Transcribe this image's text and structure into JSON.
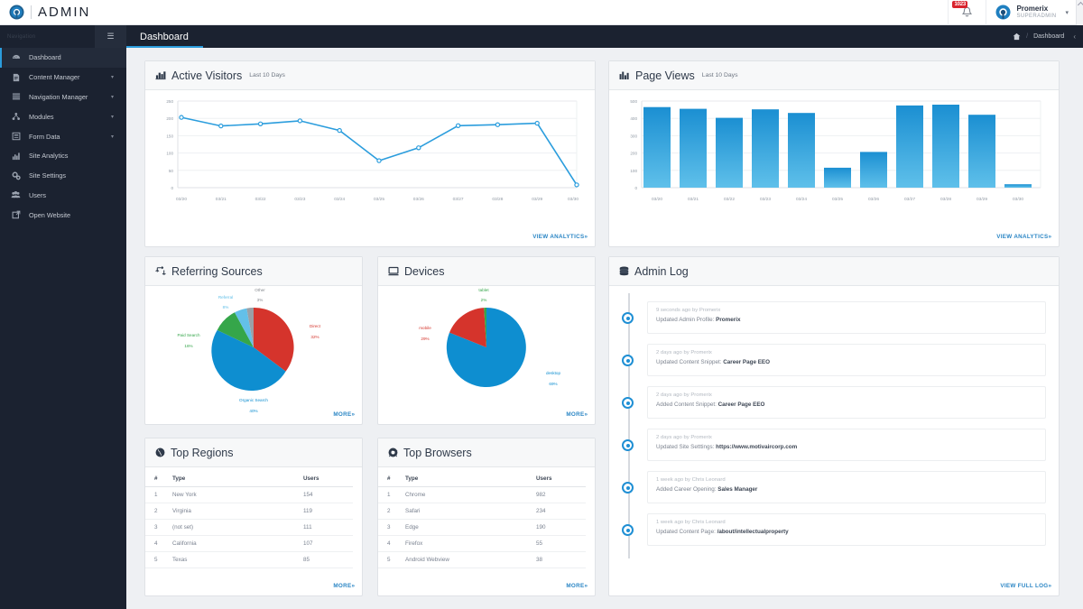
{
  "topbar": {
    "brand": "ADMIN",
    "brand_logo_icon": "target-logo-icon",
    "notification_icon": "bell-icon",
    "notification_count": "1023",
    "user_name": "Promerix",
    "user_role": "SUPERADMIN",
    "user_avatar_icon": "avatar-icon",
    "caret_icon": "chevron-down-icon"
  },
  "navstrip": {
    "nav_label": "Navigation",
    "toggle_icon": "hamburger-icon",
    "page_title": "Dashboard",
    "home_icon": "home-icon",
    "crumb_sep": "/",
    "crumb_current": "Dashboard",
    "collapse_icon": "chevron-left-icon"
  },
  "sidebar": {
    "items": [
      {
        "label": "Dashboard",
        "icon": "dashboard-icon",
        "active": true,
        "caret": false
      },
      {
        "label": "Content Manager",
        "icon": "file-icon",
        "active": false,
        "caret": true
      },
      {
        "label": "Navigation Manager",
        "icon": "list-icon",
        "active": false,
        "caret": true
      },
      {
        "label": "Modules",
        "icon": "modules-icon",
        "active": false,
        "caret": true
      },
      {
        "label": "Form Data",
        "icon": "form-icon",
        "active": false,
        "caret": true
      },
      {
        "label": "Site Analytics",
        "icon": "bar-chart-icon",
        "active": false,
        "caret": false
      },
      {
        "label": "Site Settings",
        "icon": "gear-icon",
        "active": false,
        "caret": false
      },
      {
        "label": "Users",
        "icon": "users-icon",
        "active": false,
        "caret": false
      },
      {
        "label": "Open Website",
        "icon": "external-link-icon",
        "active": false,
        "caret": false
      }
    ],
    "caret_icon": "chevron-down-icon"
  },
  "panels": {
    "active_visitors": {
      "title": "Active Visitors",
      "subtitle": "Last 10 Days",
      "icon": "area-chart-icon",
      "footer": "VIEW ANALYTICS",
      "footer_chev": "»"
    },
    "page_views": {
      "title": "Page Views",
      "subtitle": "Last 10 Days",
      "icon": "bar-chart-icon",
      "footer": "VIEW ANALYTICS",
      "footer_chev": "»"
    },
    "referring_sources": {
      "title": "Referring Sources",
      "icon": "retweet-icon",
      "footer": "MORE",
      "footer_chev": "»"
    },
    "devices": {
      "title": "Devices",
      "icon": "desktop-icon",
      "footer": "MORE",
      "footer_chev": "»"
    },
    "top_regions": {
      "title": "Top Regions",
      "icon": "globe-icon",
      "footer": "MORE",
      "footer_chev": "»",
      "columns": [
        "#",
        "Type",
        "Users"
      ],
      "rows": [
        {
          "rank": "1",
          "type": "New York",
          "users": "154"
        },
        {
          "rank": "2",
          "type": "Virginia",
          "users": "119"
        },
        {
          "rank": "3",
          "type": "(not set)",
          "users": "111"
        },
        {
          "rank": "4",
          "type": "California",
          "users": "107"
        },
        {
          "rank": "5",
          "type": "Texas",
          "users": "85"
        }
      ]
    },
    "top_browsers": {
      "title": "Top Browsers",
      "icon": "chrome-icon",
      "footer": "MORE",
      "footer_chev": "»",
      "columns": [
        "#",
        "Type",
        "Users"
      ],
      "rows": [
        {
          "rank": "1",
          "type": "Chrome",
          "users": "982"
        },
        {
          "rank": "2",
          "type": "Safari",
          "users": "234"
        },
        {
          "rank": "3",
          "type": "Edge",
          "users": "190"
        },
        {
          "rank": "4",
          "type": "Firefox",
          "users": "55"
        },
        {
          "rank": "5",
          "type": "Android Webview",
          "users": "38"
        }
      ]
    },
    "admin_log": {
      "title": "Admin Log",
      "icon": "database-icon",
      "footer": "VIEW FULL LOG",
      "footer_chev": "»",
      "entries": [
        {
          "meta": "9 seconds ago by Promerix",
          "action": "Updated Admin Profile:",
          "target": "Promerix"
        },
        {
          "meta": "2 days ago by Promerix",
          "action": "Updated Content Snippet:",
          "target": "Career Page EEO"
        },
        {
          "meta": "2 days ago by Promerix",
          "action": "Added Content Snippet:",
          "target": "Career Page EEO"
        },
        {
          "meta": "2 days ago by Promerix",
          "action": "Updated Site Setttings:",
          "target": "https://www.motivaircorp.com"
        },
        {
          "meta": "1 week ago by Chris Leonard",
          "action": "Added Career Opening:",
          "target": "Sales Manager"
        },
        {
          "meta": "1 week ago by Chris Leonard",
          "action": "Updated Content Page:",
          "target": "/about/intellectualproperty"
        }
      ]
    }
  },
  "colors": {
    "accent": "#2b9ddd",
    "sidebar_bg": "#1b2230",
    "page_bg": "#eef0f3",
    "pie_red": "#d5342c",
    "pie_blue": "#0e8ed0",
    "pie_green": "#35a64a",
    "pie_lightblue": "#63c0e8",
    "pie_gray": "#9aa0a6",
    "badge_red": "#d9232d"
  },
  "chart_data": [
    {
      "type": "line",
      "title": "Active Visitors",
      "subtitle": "Last 10 Days",
      "xlabel": "",
      "ylabel": "",
      "ylim": [
        0,
        250
      ],
      "yticks": [
        0,
        50,
        100,
        150,
        200,
        250
      ],
      "grid": true,
      "legend": "none",
      "categories": [
        "03/20",
        "03/21",
        "03/22",
        "03/23",
        "03/24",
        "03/25",
        "03/26",
        "03/27",
        "03/28",
        "03/29",
        "03/30"
      ],
      "values": [
        203,
        178,
        184,
        193,
        165,
        78,
        115,
        179,
        182,
        186,
        8
      ],
      "color": "#2b9ddd"
    },
    {
      "type": "bar",
      "title": "Page Views",
      "subtitle": "Last 10 Days",
      "xlabel": "",
      "ylabel": "",
      "ylim": [
        0,
        500
      ],
      "yticks": [
        0,
        100,
        200,
        300,
        400,
        500
      ],
      "grid": true,
      "legend": "none",
      "categories": [
        "03/20",
        "03/21",
        "03/22",
        "03/23",
        "03/24",
        "03/25",
        "03/26",
        "03/27",
        "03/28",
        "03/29",
        "03/30"
      ],
      "values": [
        465,
        455,
        403,
        452,
        431,
        115,
        206,
        474,
        479,
        421,
        20
      ],
      "color": "#1b92d4"
    },
    {
      "type": "pie",
      "title": "Referring Sources",
      "legend": "labels-outside",
      "labels": [
        "Direct",
        "Organic Search",
        "Paid Search",
        "Referral",
        "Other"
      ],
      "values": [
        32,
        40,
        16,
        8,
        3
      ],
      "value_labels": [
        "32%",
        "40%",
        "16%",
        "8%",
        "3%"
      ],
      "colors": [
        "#d5342c",
        "#0e8ed0",
        "#35a64a",
        "#63c0e8",
        "#9aa0a6"
      ]
    },
    {
      "type": "pie",
      "title": "Devices",
      "legend": "labels-outside",
      "labels": [
        "desktop",
        "mobile",
        "tablet"
      ],
      "values": [
        69,
        29,
        2
      ],
      "value_labels": [
        "69%",
        "29%",
        "2%"
      ],
      "colors": [
        "#0e8ed0",
        "#d5342c",
        "#35a64a"
      ]
    }
  ]
}
